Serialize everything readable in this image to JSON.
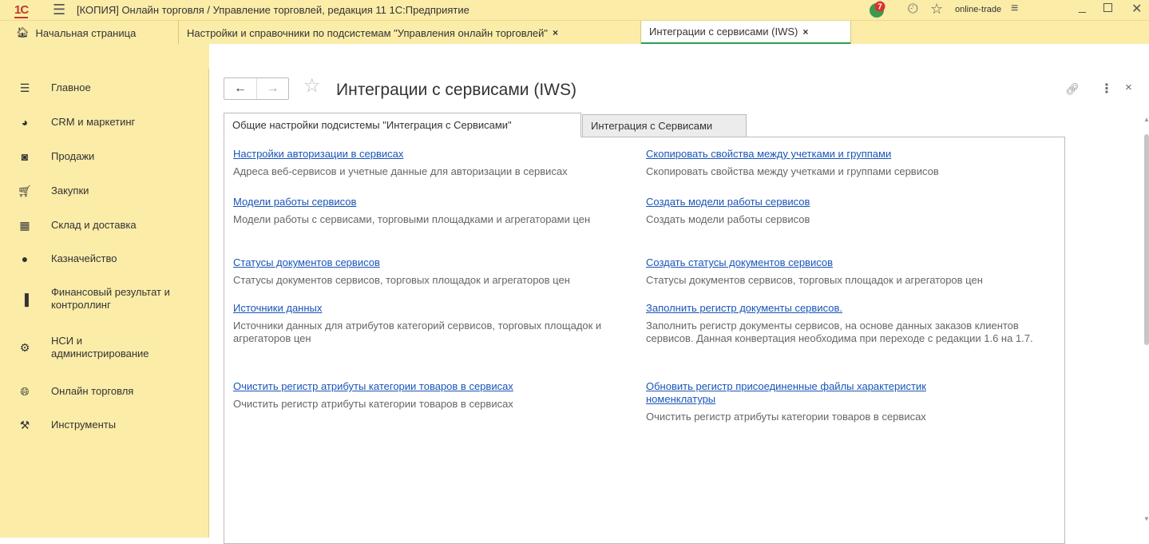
{
  "titlebar": {
    "logo": "1С",
    "title": "[КОПИЯ] Онлайн торговля / Управление торговлей, редакция 11 1С:Предприятие",
    "notifications_count": "7",
    "user": "online-trade"
  },
  "tabs": [
    {
      "label": "Начальная страница"
    },
    {
      "label": "Настройки и справочники по подсистемам \"Управления онлайн торговлей\""
    },
    {
      "label": "Интеграции с сервисами (IWS)"
    }
  ],
  "sidebar": {
    "items": [
      {
        "label": "Главное",
        "icon": "menu-lines-icon"
      },
      {
        "label": "CRM и маркетинг",
        "icon": "pie-chart-icon"
      },
      {
        "label": "Продажи",
        "icon": "shopping-bag-icon"
      },
      {
        "label": "Закупки",
        "icon": "cart-icon"
      },
      {
        "label": "Склад и доставка",
        "icon": "warehouse-icon"
      },
      {
        "label": "Казначейство",
        "icon": "ruble-coin-icon"
      },
      {
        "label": "Финансовый результат и контроллинг",
        "icon": "bar-chart-icon"
      },
      {
        "label": "НСИ и администрирование",
        "icon": "gear-icon"
      },
      {
        "label": "Онлайн торговля",
        "icon": "globe-icon"
      },
      {
        "label": "Инструменты",
        "icon": "tools-icon"
      }
    ]
  },
  "form": {
    "title": "Интеграции с сервисами (IWS)",
    "tabs": [
      {
        "label": "Общие настройки подсистемы \"Интеграция с Сервисами\""
      },
      {
        "label": "Интеграция с Сервисами"
      }
    ],
    "left": [
      {
        "link": "Настройки авторизации в сервисах",
        "desc": "Адреса веб-сервисов и учетные данные для авторизации в сервисах"
      },
      {
        "link": "Модели работы сервисов",
        "desc": "Модели работы с сервисами, торговыми площадками и агрегаторами цен"
      },
      {
        "link": "Статусы документов сервисов",
        "desc": "Статусы документов сервисов, торговых площадок и агрегаторов цен"
      },
      {
        "link": "Источники данных",
        "desc": "Источники данных для атрибутов категорий сервисов, торговых площадок и агрегаторов цен"
      },
      {
        "link": "Очистить регистр атрибуты категории товаров в сервисах",
        "desc": "Очистить регистр атрибуты категории товаров в сервисах"
      }
    ],
    "right": [
      {
        "link": "Скопировать свойства между учетками и группами",
        "desc": "Скопировать свойства между учетками и группами сервисов"
      },
      {
        "link": "Создать модели работы сервисов",
        "desc": "Создать модели работы сервисов"
      },
      {
        "link": "Создать статусы документов сервисов",
        "desc": "Статусы документов сервисов, торговых площадок и агрегаторов цен"
      },
      {
        "link": "Заполнить регистр документы сервисов.",
        "desc": "Заполнить регистр документы сервисов, на основе данных заказов клиентов сервисов. Данная конвертация необходима при переходе с редакции 1.6 на 1.7."
      },
      {
        "link": "Обновить регистр присоединенные файлы характеристик номенклатуры",
        "desc": "Очистить регистр атрибуты категории товаров в сервисах"
      }
    ]
  },
  "colors": {
    "chrome_bg": "#fbeca8",
    "link": "#1a55b8",
    "active_tab_underline": "#2e9e55",
    "badge": "#d9342b"
  }
}
